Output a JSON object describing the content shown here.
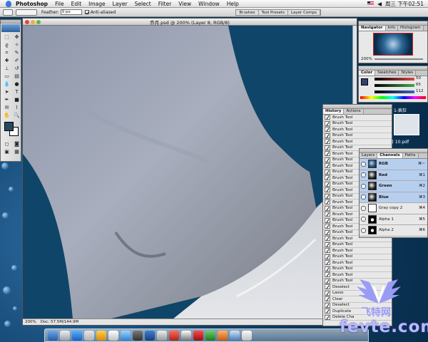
{
  "menubar": {
    "app": "Photoshop",
    "items": [
      "File",
      "Edit",
      "Image",
      "Layer",
      "Select",
      "Filter",
      "View",
      "Window",
      "Help"
    ],
    "clock": "周三 下午02:51"
  },
  "options": {
    "feather_label": "Feather:",
    "feather_value": "0 px",
    "antialiased_label": "Anti-aliased",
    "palette_well": [
      "Brushes",
      "Tool Presets",
      "Layer Comps"
    ]
  },
  "document": {
    "title": "乔月.psd @ 200% (Layer 8, RGB/8)",
    "zoom": "200%",
    "doc_size": "Doc: 57.5M/144.9M"
  },
  "navigator": {
    "tabs": [
      "Navigator",
      "Info",
      "Histogram"
    ],
    "zoom": "200%"
  },
  "color": {
    "tabs": [
      "Color",
      "Swatches",
      "Styles"
    ],
    "r": "50",
    "g": "65",
    "b": "112",
    "colors": {
      "r": "#d84848",
      "g": "#3fa94a",
      "b": "#3f62c8"
    }
  },
  "history": {
    "tabs": [
      "History",
      "Actions"
    ],
    "items": [
      "Brush Tool",
      "Brush Tool",
      "Brush Tool",
      "Brush Tool",
      "Brush Tool",
      "Brush Tool",
      "Brush Tool",
      "Brush Tool",
      "Brush Tool",
      "Brush Tool",
      "Brush Tool",
      "Brush Tool",
      "Brush Tool",
      "Brush Tool",
      "Brush Tool",
      "Brush Tool",
      "Brush Tool",
      "Brush Tool",
      "Brush Tool",
      "Brush Tool",
      "Brush Tool",
      "Brush Tool",
      "Brush Tool",
      "Brush Tool",
      "Brush Tool",
      "Brush Tool",
      "Brush Tool",
      "Brush Tool",
      "Deselect",
      "Lasso",
      "Clear",
      "Deselect",
      "Duplicate",
      "Delete Cha"
    ]
  },
  "channels": {
    "tabs": [
      "Layers",
      "Channels",
      "Paths"
    ],
    "items": [
      {
        "name": "RGB",
        "key": "⌘~",
        "selected": true
      },
      {
        "name": "Red",
        "key": "⌘1",
        "selected": true
      },
      {
        "name": "Green",
        "key": "⌘2",
        "selected": true
      },
      {
        "name": "Blue",
        "key": "⌘3",
        "selected": true
      },
      {
        "name": "Gray copy 2",
        "key": "⌘4",
        "selected": false
      },
      {
        "name": "Alpha 1",
        "key": "⌘5",
        "selected": false
      },
      {
        "name": "Alpha 2",
        "key": "⌘6",
        "selected": false
      }
    ]
  },
  "desktop": {
    "file_label": "1-疯狂",
    "pdf_label": "月 10.pdf"
  },
  "watermark": {
    "cn": "飞特网",
    "en": "fevte.com"
  }
}
